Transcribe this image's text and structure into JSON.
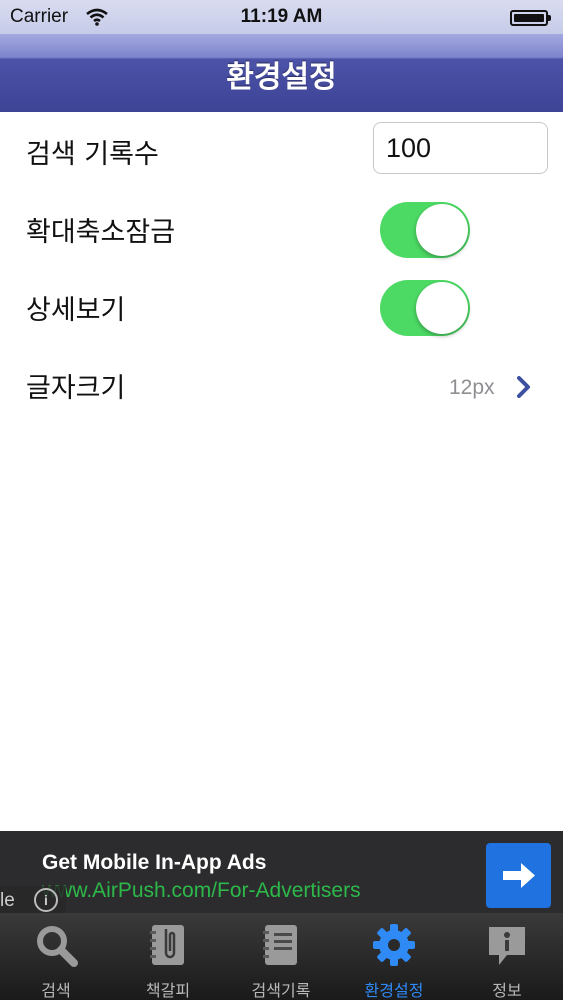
{
  "status_bar": {
    "carrier": "Carrier",
    "time": "11:19 AM"
  },
  "nav": {
    "title": "환경설정"
  },
  "settings": {
    "search_history": {
      "label": "검색 기록수",
      "value": "100"
    },
    "zoom_lock": {
      "label": "확대축소잠금",
      "on": true
    },
    "detail_view": {
      "label": "상세보기",
      "on": true
    },
    "font_size": {
      "label": "글자크기",
      "value": "12px"
    }
  },
  "ad": {
    "title": "Get Mobile In-App Ads",
    "url": "www.AirPush.com/For-Advertisers",
    "info_text": "le",
    "info_icon": "i"
  },
  "tabs": [
    {
      "label": "검색",
      "icon": "search-icon",
      "active": false
    },
    {
      "label": "책갈피",
      "icon": "bookmark-icon",
      "active": false
    },
    {
      "label": "검색기록",
      "icon": "notebook-icon",
      "active": false
    },
    {
      "label": "환경설정",
      "icon": "gear-icon",
      "active": true
    },
    {
      "label": "정보",
      "icon": "info-icon",
      "active": false
    }
  ],
  "colors": {
    "accent": "#2f8af5",
    "toggle_on": "#4cd964",
    "nav": "#3d4496"
  }
}
